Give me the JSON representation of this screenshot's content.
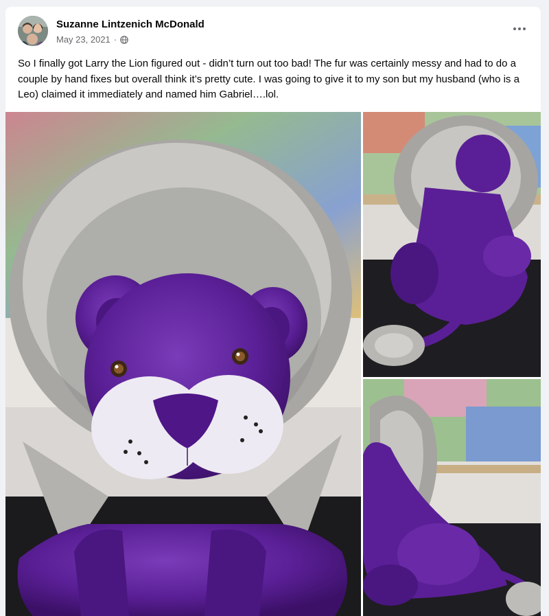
{
  "post": {
    "author": "Suzanne Lintzenich McDonald",
    "date": "May 23, 2021",
    "separator": "·",
    "audience_icon": "globe-icon",
    "more_icon": "more-options-icon",
    "caption": "So I finally got Larry the Lion figured out - didn’t turn out too bad!  The fur was certainly messy and had to do a couple by hand fixes but overall think it’s pretty cute.  I was going to give it to my son but my husband (who is a Leo) claimed it immediately and named him Gabriel….lol."
  },
  "colors": {
    "plush_purple": "#5a1f96",
    "mane_gray": "#b9b9b6",
    "muzzle_white": "#eeeaf3",
    "meta_gray": "#65676b"
  }
}
